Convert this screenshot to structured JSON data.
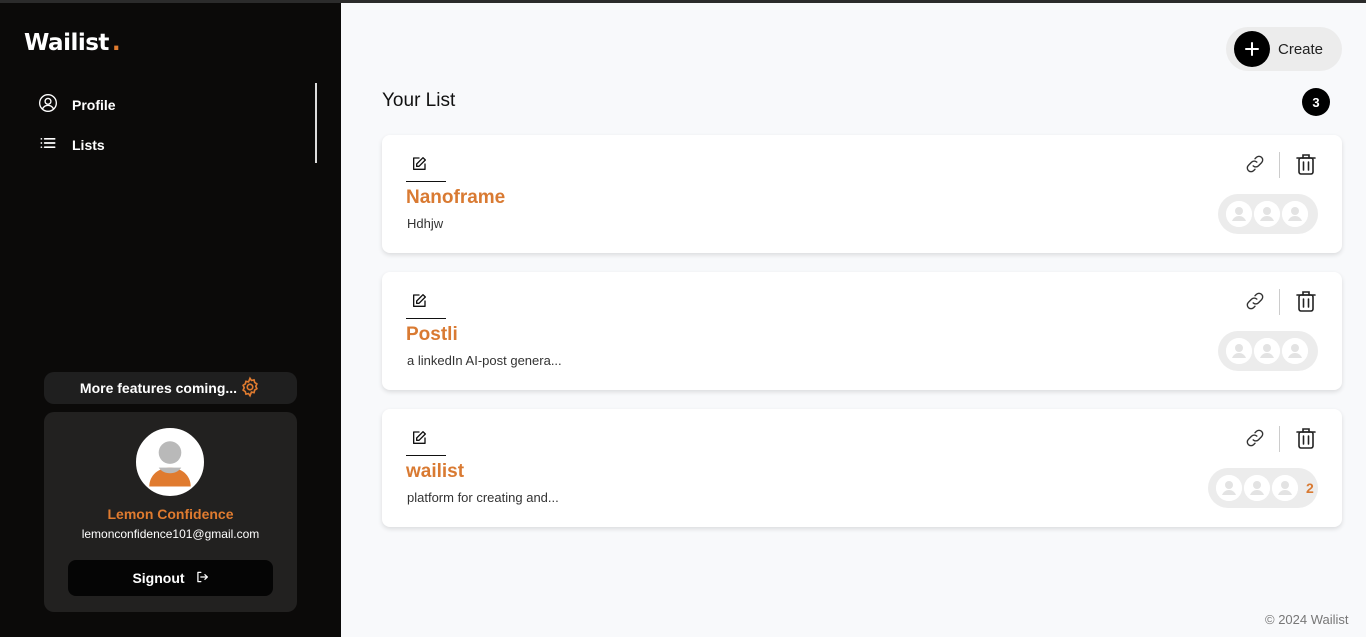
{
  "brand": {
    "name": "Wailist",
    "dot": "."
  },
  "sidebar": {
    "items": [
      {
        "label": "Profile",
        "icon": "user-circle-icon"
      },
      {
        "label": "Lists",
        "icon": "list-icon"
      }
    ],
    "features_label": "More features coming...",
    "user": {
      "name": "Lemon Confidence",
      "email": "lemonconfidence101@gmail.com"
    },
    "signout_label": "Signout"
  },
  "header": {
    "create_label": "Create"
  },
  "main": {
    "title": "Your List",
    "count": "3",
    "cards": [
      {
        "title": "Nanoframe",
        "description": "Hdhjw",
        "subscriber_count": ""
      },
      {
        "title": "Postli",
        "description": "a linkedIn AI-post genera...",
        "subscriber_count": ""
      },
      {
        "title": "wailist",
        "description": "platform for creating and...",
        "subscriber_count": "2"
      }
    ]
  },
  "footer": {
    "text": "© 2024 Wailist"
  },
  "colors": {
    "accent": "#d97a32",
    "sidebar_bg": "#0b0a09",
    "page_bg": "#f8f9fb"
  }
}
